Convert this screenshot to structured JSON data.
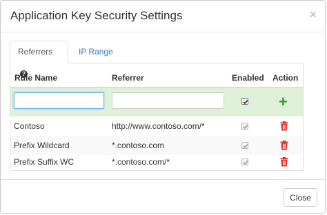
{
  "dialog": {
    "title": "Application Key Security Settings",
    "close_glyph": "×"
  },
  "tabs": [
    {
      "label": "Referrers",
      "icon": "question-circle-icon",
      "active": true
    },
    {
      "label": "IP Range",
      "active": false
    }
  ],
  "table": {
    "headers": {
      "rule_name": "Rule Name",
      "referrer": "Referrer",
      "enabled": "Enabled",
      "action": "Action"
    },
    "new_row": {
      "rule_name_value": "",
      "referrer_value": "",
      "enabled": true,
      "action_icon": "plus-icon"
    },
    "rows": [
      {
        "rule_name": "Contoso",
        "referrer": "http://www.contoso.com/*",
        "enabled": true,
        "action_icon": "trash-icon"
      },
      {
        "rule_name": "Prefix Wildcard",
        "referrer": "*.contoso.com",
        "enabled": true,
        "action_icon": "trash-icon"
      },
      {
        "rule_name": "Prefix Suffix WC",
        "referrer": "*.contoso.com/*",
        "enabled": true,
        "action_icon": "trash-icon"
      }
    ]
  },
  "footer": {
    "close_label": "Close"
  },
  "colors": {
    "accent_link": "#337ab7",
    "add_green": "#2e9c3d",
    "delete_red": "#d9281f",
    "new_row_bg": "#dff0d8"
  }
}
